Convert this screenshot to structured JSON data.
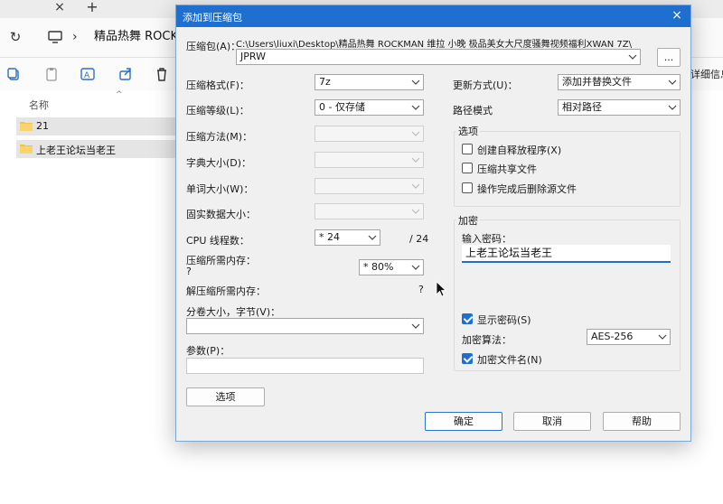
{
  "explorer": {
    "tab_close": "×",
    "tab_add": "+",
    "breadcrumb_sep": "›",
    "breadcrumb_text": "精品热舞 ROCKMAN",
    "details_label": "详细信息",
    "column_name": "名称",
    "sort_caret": "^",
    "files": [
      {
        "name": "21"
      },
      {
        "name": "上老王论坛当老王"
      }
    ]
  },
  "dialog": {
    "title": "添加到压缩包",
    "close": "×",
    "archive_label": "压缩包(A)：",
    "archive_path": "C:\\Users\\liuxi\\Desktop\\精品热舞 ROCKMAN 维拉 小晚 极品美女大尺度骚舞视频福利XWAN 7Z\\",
    "archive_name": "JPRW",
    "browse_label": "...",
    "format_label": "压缩格式(F)：",
    "format_value": "7z",
    "level_label": "压缩等级(L)：",
    "level_value": "0 - 仅存储",
    "method_label": "压缩方法(M)：",
    "dict_label": "字典大小(D)：",
    "word_label": "单词大小(W)：",
    "solid_label": "固实数据大小：",
    "cpu_label": "CPU 线程数：",
    "cpu_value": "* 24",
    "cpu_total": "/ 24",
    "mem_label": "压缩所需内存：",
    "mem_q": "?",
    "mem_value": "* 80%",
    "decomp_label": "解压缩所需内存：",
    "decomp_q": "?",
    "split_label": "分卷大小，字节(V)：",
    "params_label": "参数(P)：",
    "options_btn": "选项",
    "update_label": "更新方式(U)：",
    "update_value": "添加并替换文件",
    "path_label": "路径模式",
    "path_value": "相对路径",
    "options_group": "选项",
    "opt_sfx": "创建自释放程序(X)",
    "opt_shared": "压缩共享文件",
    "opt_delete": "操作完成后删除源文件",
    "encrypt_group": "加密",
    "pwd_label": "输入密码：",
    "pwd_value": "上老王论坛当老王",
    "show_pwd": "显示密码(S)",
    "enc_method_label": "加密算法：",
    "enc_method_value": "AES-256",
    "enc_names": "加密文件名(N)",
    "ok": "确定",
    "cancel": "取消",
    "help": "帮助"
  }
}
